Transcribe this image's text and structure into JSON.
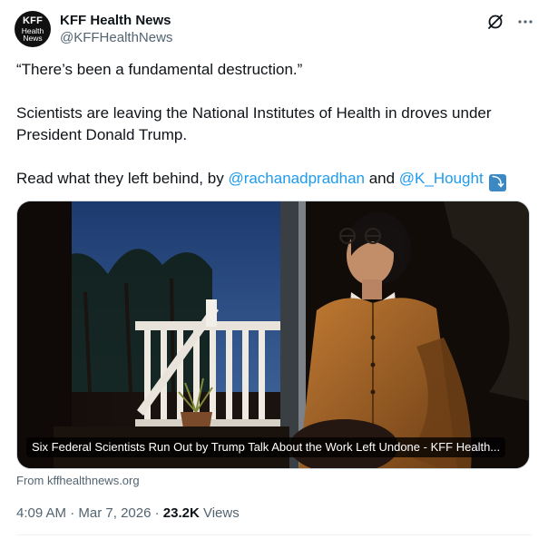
{
  "author": {
    "display_name": "KFF Health News",
    "handle": "@KFFHealthNews",
    "avatar": {
      "line1": "KFF",
      "line2": "Health",
      "line3": "News"
    }
  },
  "header_actions": {
    "grok_icon": "grok-slash-icon",
    "more_icon": "more-horizontal-icon"
  },
  "post": {
    "quote": "“There’s been a fundamental destruction.”",
    "para2": "Scientists are leaving the National Institutes of Health in droves under President Donald Trump.",
    "para3_prefix": "Read what they left behind, by ",
    "mention1": "@rachanadpradhan",
    "conjunction": " and ",
    "mention2": "@K_Hought",
    "emoji": "⤵"
  },
  "link_card": {
    "title": "Six Federal Scientists Run Out by Trump Talk About the Work Left Undone - KFF Health...",
    "source": "From kffhealthnews.org"
  },
  "meta": {
    "time": "4:09 AM",
    "separator": " · ",
    "date": "Mar 7, 2026",
    "views_count": "23.2K",
    "views_label": "Views"
  }
}
